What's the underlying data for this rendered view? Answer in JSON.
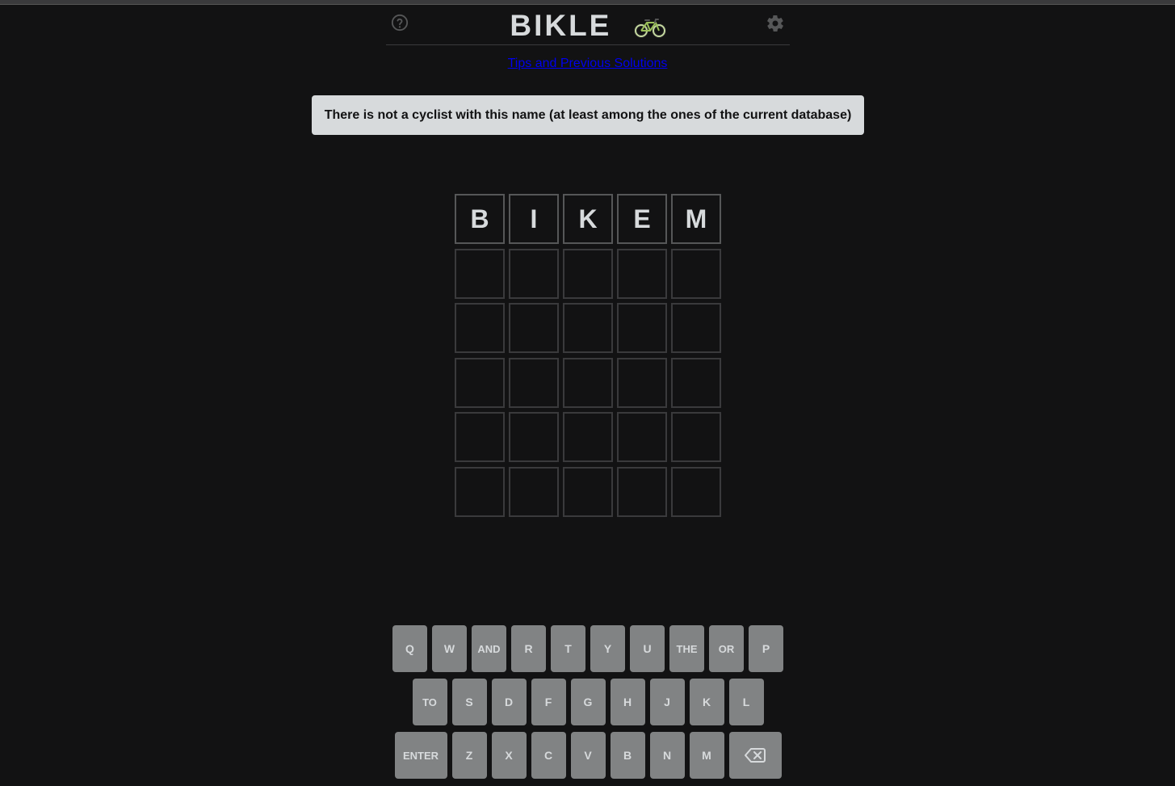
{
  "header": {
    "title": "BIKLE",
    "help_icon": "question-circle-icon",
    "settings_icon": "gear-icon",
    "title_icon": "bicycle-icon"
  },
  "tips_link": "Tips and Previous Solutions",
  "toast": "There is not a cyclist with this name (at least among the ones of the current database)",
  "board": {
    "rows": [
      [
        "B",
        "I",
        "K",
        "E",
        "M"
      ],
      [
        "",
        "",
        "",
        "",
        ""
      ],
      [
        "",
        "",
        "",
        "",
        ""
      ],
      [
        "",
        "",
        "",
        "",
        ""
      ],
      [
        "",
        "",
        "",
        "",
        ""
      ],
      [
        "",
        "",
        "",
        "",
        ""
      ]
    ]
  },
  "keyboard": {
    "row1": [
      "Q",
      "W",
      "AND",
      "R",
      "T",
      "Y",
      "U",
      "THE",
      "OR",
      "P"
    ],
    "row2": [
      "TO",
      "S",
      "D",
      "F",
      "G",
      "H",
      "J",
      "K",
      "L"
    ],
    "row3": [
      "ENTER",
      "Z",
      "X",
      "C",
      "V",
      "B",
      "N",
      "M"
    ],
    "backspace_icon": "backspace-icon"
  },
  "colors": {
    "background": "#121213",
    "tile_border": "#3a3a3c",
    "key": "#818384",
    "toast": "#d7dadc",
    "link": "#0000ee"
  }
}
